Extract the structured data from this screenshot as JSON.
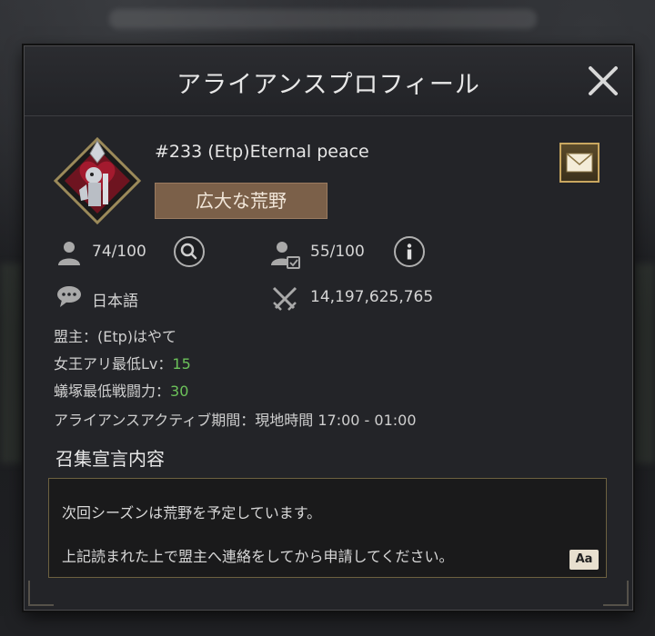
{
  "dialog": {
    "title": "アライアンスプロフィール"
  },
  "alliance": {
    "name_line": "#233 (Etp)Eternal peace",
    "region": "広大な荒野"
  },
  "stats": {
    "members": "74/100",
    "applicants": "55/100",
    "language": "日本語",
    "power": "14,197,625,765"
  },
  "info": {
    "leader": "盟主：(Etp)はやて",
    "queen_label": "女王アリ最低Lv：",
    "queen_value": "15",
    "power_label": "蟻塚最低戦闘力：",
    "power_value": "30",
    "active_time": "アライアンスアクティブ期間：現地時間 17:00 - 01:00"
  },
  "declaration": {
    "section_title": "召集宣言内容",
    "line1": "次回シーズンは荒野を予定しています。",
    "line2": "上記読まれた上で盟主へ連絡をしてから申請してください。",
    "translate_label": "Aa"
  },
  "icons": {
    "close": "close-icon",
    "mail": "mail-icon",
    "members": "person-icon",
    "search": "search-icon",
    "applicants": "person-calendar-icon",
    "info": "info-icon",
    "language": "chat-bubble-icon",
    "power": "crossed-swords-icon"
  },
  "colors": {
    "accent_gold": "#c9a760",
    "badge_brown": "#7b6049",
    "value_green": "#6cc25a"
  }
}
